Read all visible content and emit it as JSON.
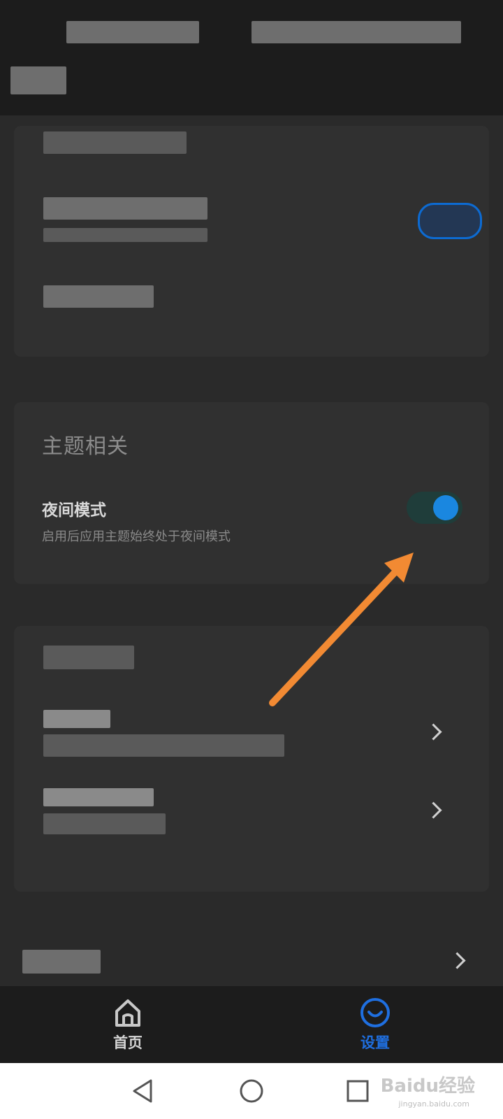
{
  "theme_section": {
    "title": "主题相关",
    "night_mode": {
      "title": "夜间模式",
      "description": "启用后应用主题始终处于夜间模式",
      "enabled": true
    }
  },
  "bottom_nav": {
    "items": [
      {
        "label": "首页",
        "icon": "home-icon",
        "active": false
      },
      {
        "label": "设置",
        "icon": "smile-icon",
        "active": true
      }
    ]
  },
  "system_nav": [
    "back-icon",
    "home-circle-icon",
    "recents-icon"
  ],
  "watermark": {
    "text": "Baidu经验",
    "sub": "jingyan.baidu.com"
  },
  "colors": {
    "accent": "#1f6fe0",
    "toggle_knob": "#1a87e0",
    "annotation_arrow": "#f28a33"
  }
}
